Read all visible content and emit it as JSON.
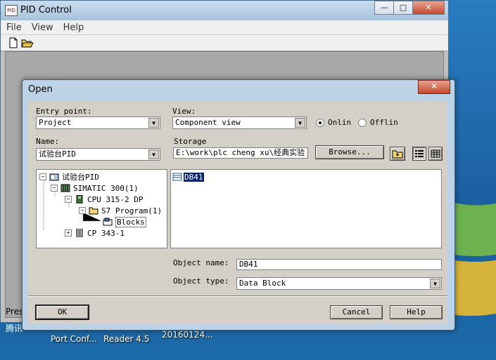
{
  "desktop": {
    "labels": [
      "Port Conf...",
      "Reader 4.5",
      "20160124..."
    ],
    "tengxun": "腾讯",
    "press": "Pres"
  },
  "pid_window": {
    "title": "PID Control",
    "menu": [
      "File",
      "View",
      "Help"
    ],
    "min_label": "—",
    "max_label": "□",
    "close_label": "✕"
  },
  "dialog": {
    "title": "Open",
    "close_label": "✕",
    "entry_point_label": "Entry point:",
    "entry_point_value": "Project",
    "view_label": "View:",
    "view_value": "Component view",
    "online_label": "Onlin",
    "offline_label": "Offlin",
    "name_label": "Name:",
    "name_value": "试验台PID",
    "storage_label": "Storage",
    "storage_value": "E:\\work\\plc cheng xu\\经典实验 号",
    "browse_label": "Browse...",
    "tree": [
      {
        "label": "试验台PID",
        "expander": "−"
      },
      {
        "label": "SIMATIC 300(1)",
        "expander": "−"
      },
      {
        "label": "CPU 315-2 DP",
        "expander": "−"
      },
      {
        "label": "S7 Program(1)",
        "expander": "−"
      },
      {
        "label": "Blocks",
        "expander": ""
      },
      {
        "label": "CP 343-1",
        "expander": "+"
      }
    ],
    "list_items": [
      "DB41"
    ],
    "object_name_label": "Object name:",
    "object_name_value": "DB41",
    "object_type_label": "Object type:",
    "object_type_value": "Data Block",
    "ok_label": "OK",
    "cancel_label": "Cancel",
    "help_label": "Help"
  }
}
